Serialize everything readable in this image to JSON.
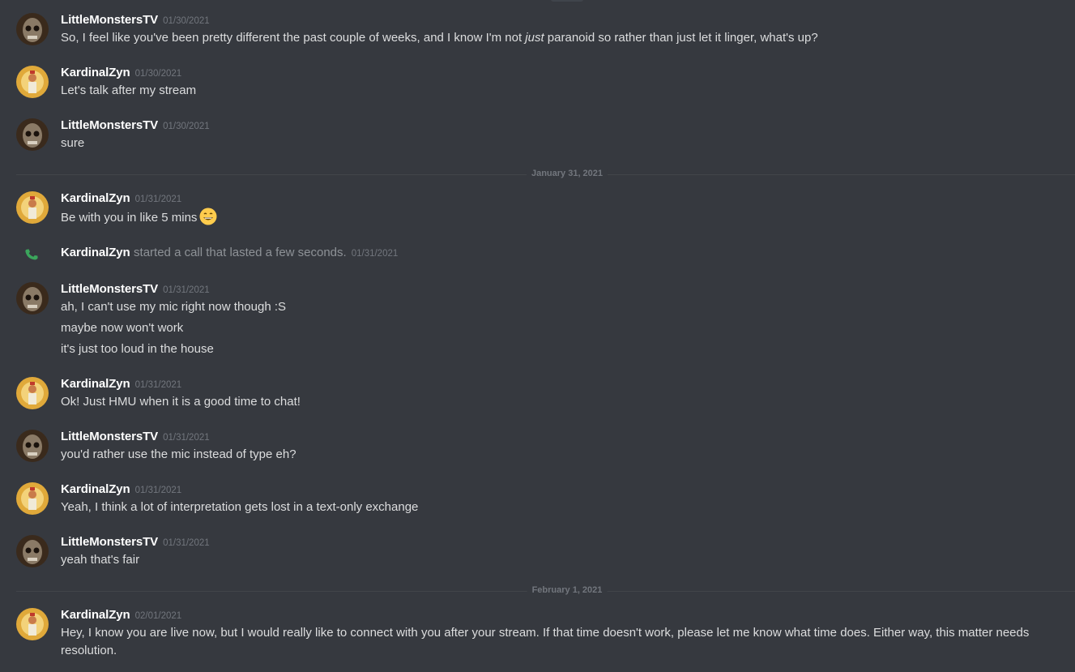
{
  "users": {
    "little": "LittleMonstersTV",
    "kardinal": "KardinalZyn"
  },
  "messages": [
    {
      "author": "LittleMonstersTV",
      "time": "01/30/2021",
      "lines": [
        "So, I feel like you've been pretty different the past couple of weeks, and I know I'm not ",
        "just",
        " paranoid so rather than just let it linger, what's up?"
      ]
    },
    {
      "author": "KardinalZyn",
      "time": "01/30/2021",
      "lines": [
        "Let's talk after my stream"
      ]
    },
    {
      "author": "LittleMonstersTV",
      "time": "01/30/2021",
      "lines": [
        "sure"
      ]
    },
    {
      "author": "KardinalZyn",
      "time": "01/31/2021",
      "lines": [
        "Be with you in like 5 mins"
      ]
    },
    {
      "author": "LittleMonstersTV",
      "time": "01/31/2021",
      "lines": [
        "ah, I can't use my mic right now though :S",
        "maybe now won't work",
        "it's just too loud in the house"
      ]
    },
    {
      "author": "KardinalZyn",
      "time": "01/31/2021",
      "lines": [
        "Ok! Just HMU when it is a good time to chat!"
      ]
    },
    {
      "author": "LittleMonstersTV",
      "time": "01/31/2021",
      "lines": [
        "you'd rather use the mic instead of type eh?"
      ]
    },
    {
      "author": "KardinalZyn",
      "time": "01/31/2021",
      "lines": [
        "Yeah, I think a lot of interpretation gets lost in a text-only exchange"
      ]
    },
    {
      "author": "LittleMonstersTV",
      "time": "01/31/2021",
      "lines": [
        "yeah that's fair"
      ]
    },
    {
      "author": "KardinalZyn",
      "time": "02/01/2021",
      "lines": [
        "Hey, I know you are live now, but I would really like to connect with you after your stream. If that time doesn't work, please let me know what time does. Either way, this matter needs",
        "resolution."
      ]
    }
  ],
  "call": {
    "author": "KardinalZyn",
    "text": "started a call that lasted a few seconds.",
    "time": "01/31/2021"
  },
  "dividers": {
    "jan31": "January 31, 2021",
    "feb1": "February 1, 2021"
  },
  "colors": {
    "background": "#36393f",
    "username": "#ffffff",
    "text": "#dcddde",
    "muted": "#72767d",
    "call_green": "#3ba55c"
  },
  "icons": {
    "call": "phone-icon",
    "emoji": "grinning-face-emoji"
  }
}
